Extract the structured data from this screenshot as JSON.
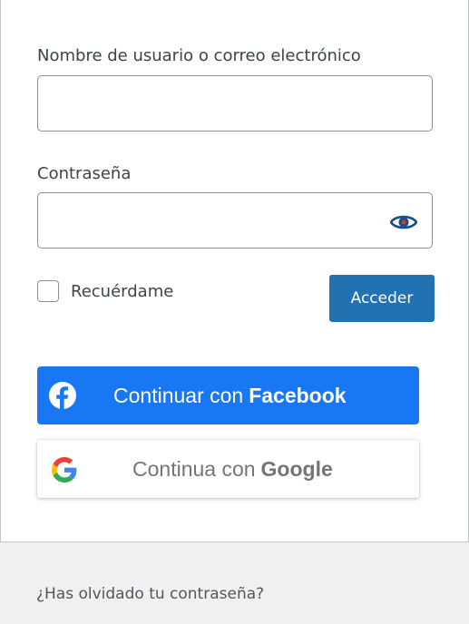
{
  "form": {
    "username_label": "Nombre de usuario o correo electrónico",
    "username_value": "",
    "password_label": "Contraseña",
    "password_value": "",
    "remember_label": "Recuérdame",
    "remember_checked": false,
    "submit_label": "Acceder"
  },
  "social": {
    "facebook": {
      "prefix": "Continuar con",
      "brand": "Facebook",
      "icon": "facebook-icon",
      "color": "#1877f2"
    },
    "google": {
      "prefix": "Continua con",
      "brand": "Google",
      "icon": "google-icon"
    }
  },
  "footer": {
    "lost_password_label": "¿Has olvidado tu contraseña?"
  },
  "colors": {
    "primary": "#2271b1",
    "background": "#f0f0f1"
  }
}
